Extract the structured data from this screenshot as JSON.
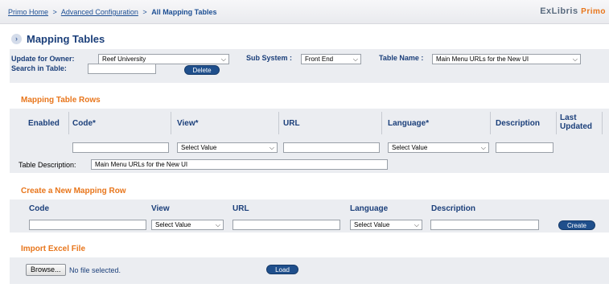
{
  "breadcrumb": {
    "home": "Primo Home",
    "advanced": "Advanced Configuration",
    "current": "All Mapping Tables",
    "separator": ">"
  },
  "logo": {
    "exlibris": "ExLibris",
    "primo": "Primo"
  },
  "page": {
    "title": "Mapping Tables",
    "expand_icon": "chevron-right-icon"
  },
  "filters": {
    "owner_label": "Update for Owner:",
    "owner_value": "Reef University",
    "subsystem_label": "Sub System :",
    "subsystem_value": "Front End",
    "table_name_label": "Table Name :",
    "table_name_value": "Main Menu URLs for the New UI",
    "search_label": "Search in Table:",
    "search_value": "",
    "delete_label": "Delete"
  },
  "rows_section": {
    "title": "Mapping Table Rows",
    "columns": {
      "enabled": "Enabled",
      "code": "Code*",
      "view": "View*",
      "url": "URL",
      "language": "Language*",
      "description": "Description",
      "last_updated_1": "Last",
      "last_updated_2": "Updated"
    },
    "view_filter": "Select Value",
    "language_filter": "Select Value",
    "table_description_label": "Table Description:",
    "table_description_value": "Main Menu URLs for the New UI"
  },
  "new_row": {
    "title": "Create a New Mapping Row",
    "code": "Code",
    "view": "View",
    "url": "URL",
    "language": "Language",
    "description": "Description",
    "view_value": "Select Value",
    "language_value": "Select Value",
    "create_label": "Create"
  },
  "import": {
    "title": "Import Excel File",
    "browse_label": "Browse...",
    "no_file": "No file selected.",
    "load_label": "Load"
  },
  "colors": {
    "accent": "#e8761c",
    "navy": "#1b3f7a",
    "button": "#1f4f8c",
    "panel": "#ebedf1"
  }
}
